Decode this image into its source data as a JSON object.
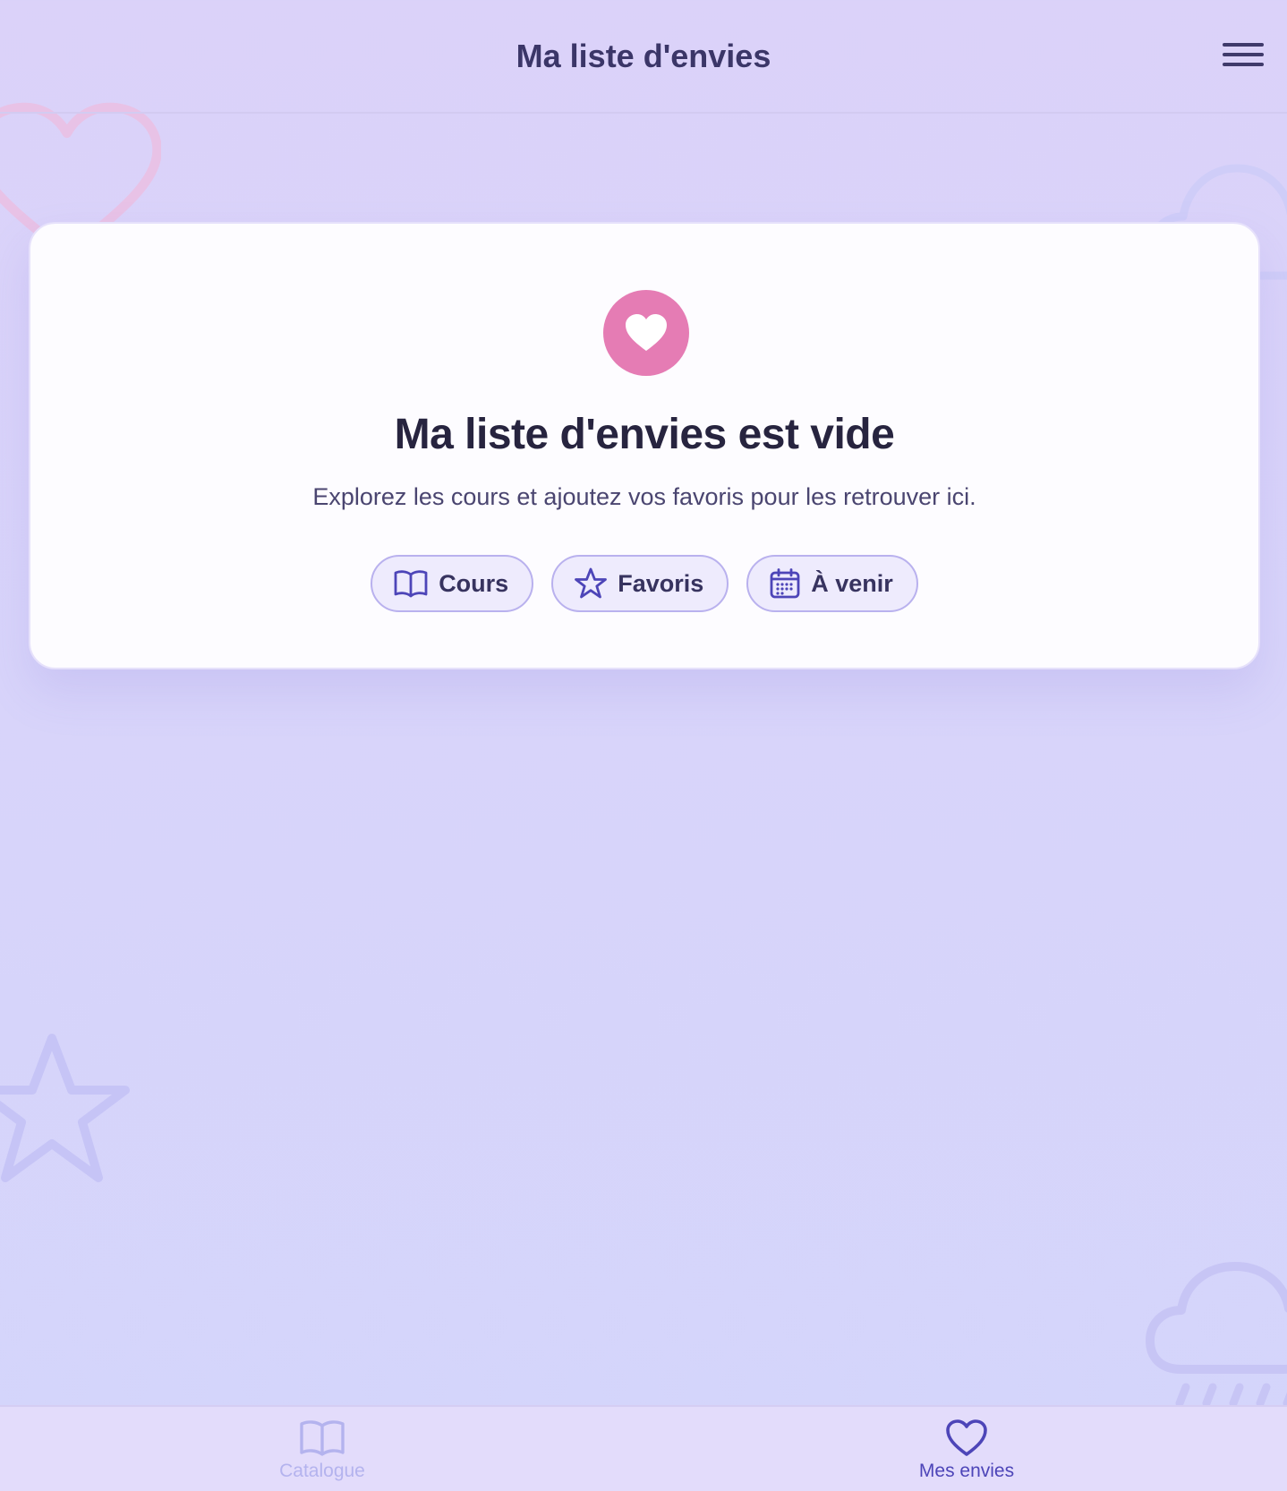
{
  "header": {
    "title": "Ma liste d'envies",
    "menu_icon": "hamburger-menu-icon"
  },
  "empty_state": {
    "icon": "heart-icon",
    "icon_color": "#e57cb4",
    "title": "Ma liste d'envies est vide",
    "subtitle": "Explorez les cours et ajoutez vos favoris pour les retrouver ici.",
    "chips": [
      {
        "label": "Cours",
        "icon": "book-open-icon"
      },
      {
        "label": "Favoris",
        "icon": "star-icon"
      },
      {
        "label": "À venir",
        "icon": "calendar-icon"
      }
    ]
  },
  "bottom_nav": {
    "items": [
      {
        "label": "Catalogue",
        "icon": "book-open-icon",
        "active": false
      },
      {
        "label": "Mes envies",
        "icon": "heart-icon",
        "active": true
      }
    ],
    "active_color": "#4d45b8",
    "inactive_color": "#b4b3ee"
  },
  "decorations": [
    "heart-icon",
    "cloud-icon",
    "star-icon",
    "rain-cloud-icon"
  ],
  "colors": {
    "background": "#d8d4fa",
    "accent": "#e57cb4",
    "primary": "#4d45b8"
  }
}
